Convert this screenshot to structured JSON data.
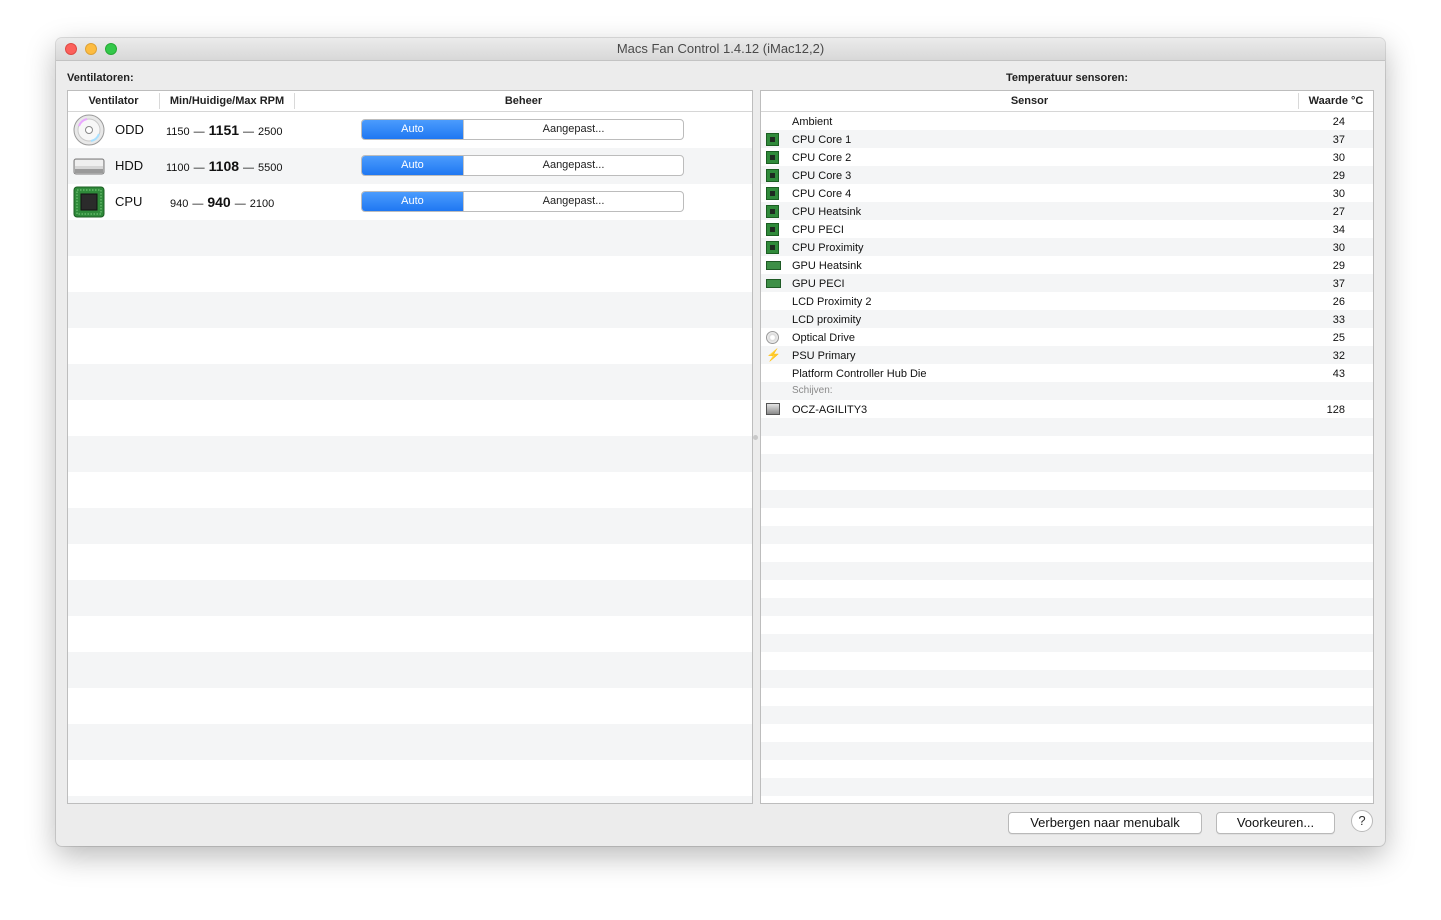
{
  "window": {
    "title": "Macs Fan Control 1.4.12 (iMac12,2)"
  },
  "fans": {
    "section_label": "Ventilatoren:",
    "headers": {
      "fan": "Ventilator",
      "rpm": "Min/Huidige/Max RPM",
      "control": "Beheer"
    },
    "items": [
      {
        "name": "ODD",
        "min": "1150",
        "current": "1151",
        "max": "2500",
        "auto_label": "Auto",
        "custom_label": "Aangepast...",
        "icon": "optical-drive-icon"
      },
      {
        "name": "HDD",
        "min": "1100",
        "current": "1108",
        "max": "5500",
        "auto_label": "Auto",
        "custom_label": "Aangepast...",
        "icon": "hard-drive-icon"
      },
      {
        "name": "CPU",
        "min": "940",
        "current": "940",
        "max": "2100",
        "auto_label": "Auto",
        "custom_label": "Aangepast...",
        "icon": "cpu-chip-icon"
      }
    ]
  },
  "sensors": {
    "section_label": "Temperatuur sensoren:",
    "headers": {
      "sensor": "Sensor",
      "value": "Waarde °C"
    },
    "items": [
      {
        "name": "Ambient",
        "value": "24",
        "icon": "none"
      },
      {
        "name": "CPU Core 1",
        "value": "37",
        "icon": "cpu-chip-icon"
      },
      {
        "name": "CPU Core 2",
        "value": "30",
        "icon": "cpu-chip-icon"
      },
      {
        "name": "CPU Core 3",
        "value": "29",
        "icon": "cpu-chip-icon"
      },
      {
        "name": "CPU Core 4",
        "value": "30",
        "icon": "cpu-chip-icon"
      },
      {
        "name": "CPU Heatsink",
        "value": "27",
        "icon": "cpu-chip-icon"
      },
      {
        "name": "CPU PECI",
        "value": "34",
        "icon": "cpu-chip-icon"
      },
      {
        "name": "CPU Proximity",
        "value": "30",
        "icon": "cpu-chip-icon"
      },
      {
        "name": "GPU Heatsink",
        "value": "29",
        "icon": "gpu-card-icon"
      },
      {
        "name": "GPU PECI",
        "value": "37",
        "icon": "gpu-card-icon"
      },
      {
        "name": "LCD Proximity 2",
        "value": "26",
        "icon": "none"
      },
      {
        "name": "LCD proximity",
        "value": "33",
        "icon": "none"
      },
      {
        "name": "Optical Drive",
        "value": "25",
        "icon": "optical-drive-icon"
      },
      {
        "name": "PSU Primary",
        "value": "32",
        "icon": "lightning-icon"
      },
      {
        "name": "Platform Controller Hub Die",
        "value": "43",
        "icon": "none"
      }
    ],
    "group_label": "Schijven:",
    "disks": [
      {
        "name": "OCZ-AGILITY3",
        "value": "128",
        "icon": "hard-drive-icon"
      }
    ]
  },
  "footer": {
    "hide_button": "Verbergen naar menubalk",
    "prefs_button": "Voorkeuren...",
    "help_button": "?"
  }
}
